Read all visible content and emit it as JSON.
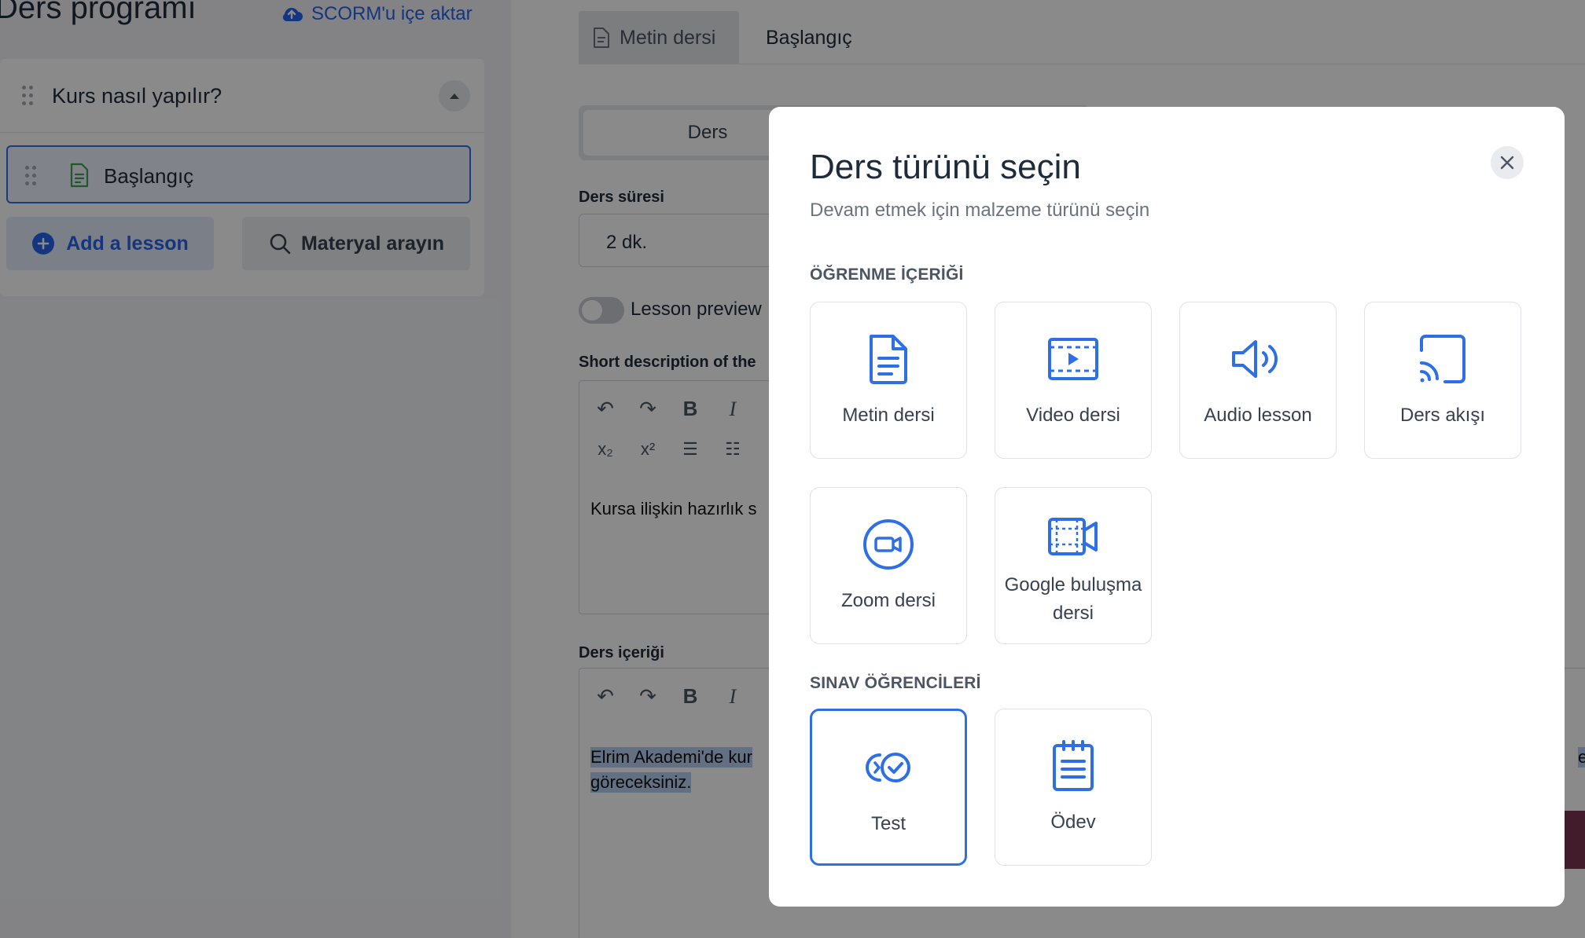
{
  "left": {
    "title": "Ders programı",
    "scorm_label": "SCORM'u içe aktar",
    "section_title": "Kurs nasıl yapılır?",
    "lesson_title": "Başlangıç",
    "add_lesson": "Add a lesson",
    "search_material": "Materyal arayın"
  },
  "editor": {
    "tabs": [
      "Metin dersi",
      "Başlangıç"
    ],
    "segment_active": "Ders",
    "duration_label": "Ders süresi",
    "duration_value": "2 dk.",
    "preview_label": "Lesson preview",
    "short_desc_label": "Short description of the",
    "short_desc_text": "Kursa ilişkin hazırlık s",
    "content_label": "Ders içeriği",
    "content_line1": "Elrim Akademi'de kur",
    "content_line1_tail": "ek",
    "content_line2": "göreceksiniz."
  },
  "modal": {
    "title": "Ders türünü seçin",
    "subtitle": "Devam etmek için malzeme türünü seçin",
    "section_learning": "ÖĞRENME İÇERİĞİ",
    "section_exam": "SINAV ÖĞRENCİLERİ",
    "learning_items": [
      {
        "label": "Metin dersi",
        "icon": "text-document-icon"
      },
      {
        "label": "Video dersi",
        "icon": "video-icon"
      },
      {
        "label": "Audio lesson",
        "icon": "audio-icon"
      },
      {
        "label": "Ders akışı",
        "icon": "stream-icon"
      },
      {
        "label": "Zoom dersi",
        "icon": "zoom-icon"
      },
      {
        "label": "Google buluşma dersi",
        "icon": "google-meet-icon"
      }
    ],
    "exam_items": [
      {
        "label": "Test",
        "icon": "quiz-icon"
      },
      {
        "label": "Ödev",
        "icon": "assignment-icon"
      }
    ],
    "selected": "Test"
  },
  "colors": {
    "accent": "#2f6fe6",
    "overlay": "rgba(0,0,0,0.46)",
    "title": "#1e2b3a"
  }
}
